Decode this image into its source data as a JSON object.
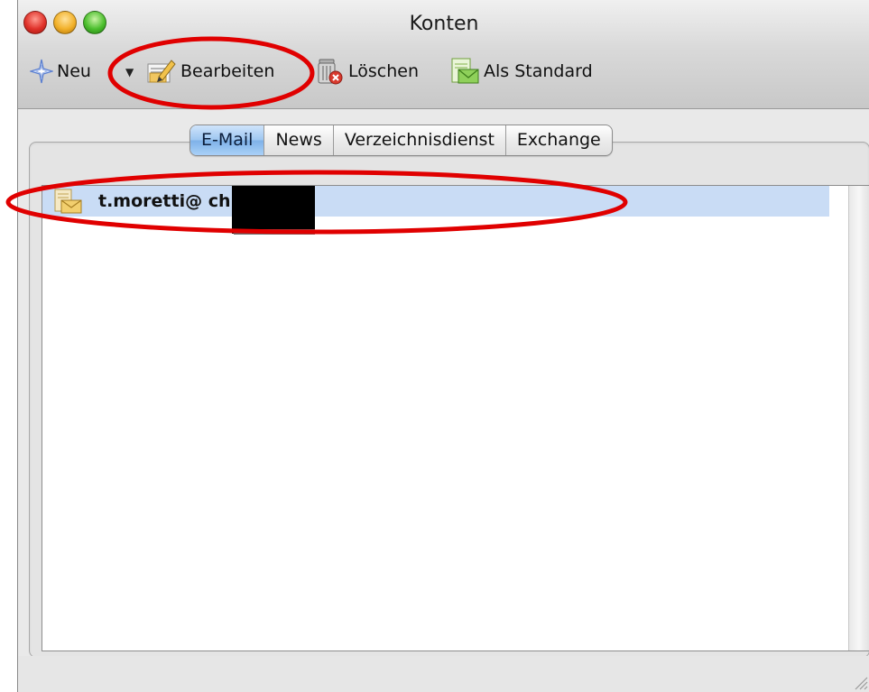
{
  "window": {
    "title": "Konten",
    "traffic_lights": [
      "close",
      "minimize",
      "zoom"
    ]
  },
  "toolbar": {
    "new_label": "Neu",
    "new_icon": "sparkle-icon",
    "edit_label": "Bearbeiten",
    "edit_icon": "edit-pencil-icon",
    "delete_label": "Löschen",
    "delete_icon": "trash-icon",
    "default_label": "Als Standard",
    "default_icon": "default-mail-icon"
  },
  "tabs": [
    {
      "label": "E-Mail",
      "active": true
    },
    {
      "label": "News",
      "active": false
    },
    {
      "label": "Verzeichnisdienst",
      "active": false
    },
    {
      "label": "Exchange",
      "active": false
    }
  ],
  "accounts": [
    {
      "text": "t.moretti@          ch (POP)",
      "icon": "mail-account-icon",
      "selected": true
    }
  ],
  "colors": {
    "annotation": "#e00000",
    "selection": "#c9dcf5",
    "active_tab": "#8fbcf0"
  }
}
